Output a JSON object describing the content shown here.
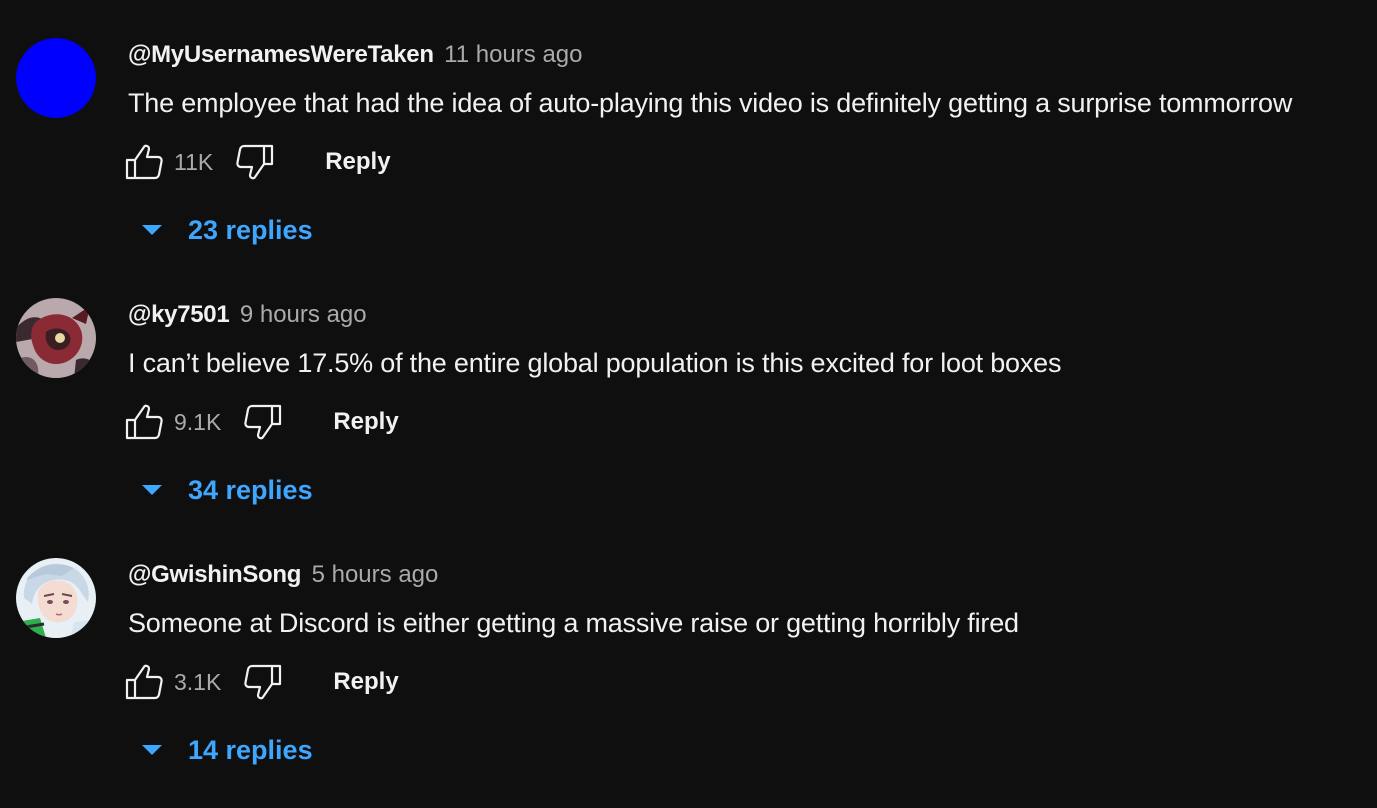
{
  "comments": [
    {
      "author": "@MyUsernamesWereTaken",
      "time": "11 hours ago",
      "text": "The employee that had the idea of auto-playing this video is definitely getting a surprise tommorrow",
      "likes": "11K",
      "reply_label": "Reply",
      "replies_label": "23 replies",
      "avatar": {
        "type": "solid-circle",
        "color": "#0000ff"
      }
    },
    {
      "author": "@ky7501",
      "time": "9 hours ago",
      "text": "I can’t believe 17.5% of the entire global population is this excited for loot boxes",
      "likes": "9.1K",
      "reply_label": "Reply",
      "replies_label": "34 replies",
      "avatar": {
        "type": "illustrated-character",
        "colors": [
          "#b9a9ac",
          "#8a2a35",
          "#3a2a2f"
        ]
      }
    },
    {
      "author": "@GwishinSong",
      "time": "5 hours ago",
      "text": "Someone at Discord is either getting a massive raise or getting horribly fired",
      "likes": "3.1K",
      "reply_label": "Reply",
      "replies_label": "14 replies",
      "avatar": {
        "type": "anime-portrait",
        "colors": [
          "#e8f0f6",
          "#c9d8e6",
          "#2fae4e"
        ]
      }
    }
  ],
  "icons": {
    "like": "thumbs-up-outline-icon",
    "dislike": "thumbs-down-outline-icon",
    "expand": "caret-down-icon"
  },
  "colors": {
    "background": "#0f0f0f",
    "primary_text": "#f1f1f1",
    "secondary_text": "#aaaaaa",
    "link_blue": "#3ea6ff"
  }
}
